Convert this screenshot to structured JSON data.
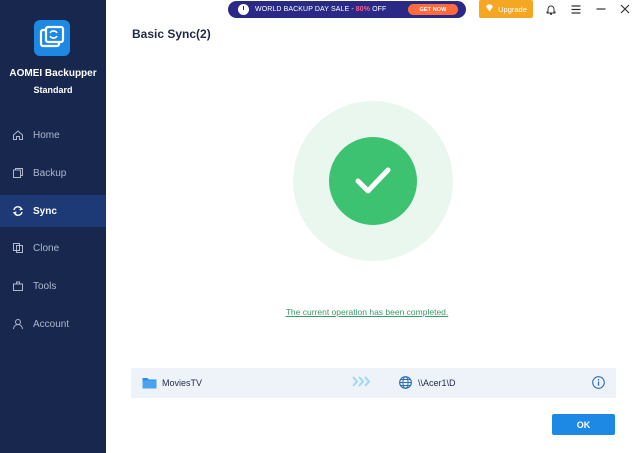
{
  "sidebar": {
    "app_name": "AOMEI Backupper",
    "edition": "Standard",
    "items": [
      {
        "label": "Home",
        "icon": "home-icon"
      },
      {
        "label": "Backup",
        "icon": "backup-icon"
      },
      {
        "label": "Sync",
        "icon": "sync-icon",
        "active": true
      },
      {
        "label": "Clone",
        "icon": "clone-icon"
      },
      {
        "label": "Tools",
        "icon": "tools-icon"
      },
      {
        "label": "Account",
        "icon": "account-icon"
      }
    ]
  },
  "topbar": {
    "promo_text_before": "WORLD BACKUP DAY SALE - ",
    "promo_discount": "80%",
    "promo_text_after": " OFF",
    "promo_button": "GET NOW",
    "upgrade_label": "Upgrade",
    "icons": [
      "bell-icon",
      "menu-icon",
      "minimize-icon",
      "close-icon"
    ]
  },
  "main": {
    "title": "Basic Sync(2)",
    "status_message": "The current operation has been completed.",
    "task": {
      "source": "MoviesTV",
      "destination": "\\\\Acer1\\D"
    },
    "ok_label": "OK"
  },
  "colors": {
    "sidebar_bg": "#17274e",
    "sidebar_active": "#1d3a77",
    "accent": "#1e88e5",
    "success": "#3cc271",
    "upgrade": "#f5a623"
  }
}
